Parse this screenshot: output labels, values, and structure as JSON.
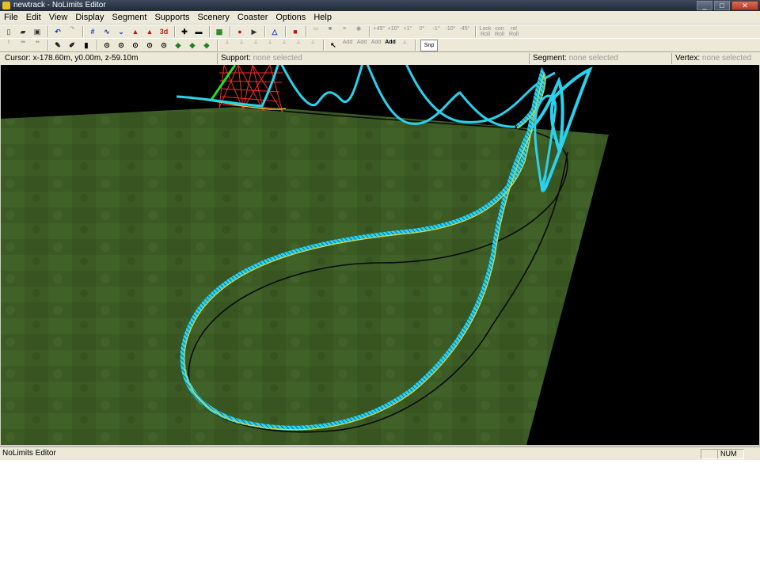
{
  "window": {
    "title": "newtrack - NoLimits Editor"
  },
  "window_buttons": [
    "_",
    "□",
    "✕"
  ],
  "menu": [
    "File",
    "Edit",
    "View",
    "Display",
    "Segment",
    "Supports",
    "Scenery",
    "Coaster",
    "Options",
    "Help"
  ],
  "toolbar_top": {
    "view_3d": "3d",
    "roll_tools": [
      "+45°",
      "+10°",
      "+1°",
      "0°",
      "-1°",
      "-10°",
      "-45°"
    ],
    "lock_roll": "Lock\nRoll",
    "con_roll": "con\nRoll",
    "rel_roll": "rel\nRoll"
  },
  "toolbar_bottom": {
    "add_tools": [
      "Add",
      "Add",
      "Add",
      "Add"
    ],
    "snap": "Snp"
  },
  "status": {
    "cursor_label": "Cursor:",
    "cursor_value": "x-178.60m, y0.00m, z-59.10m",
    "support_label": "Support:",
    "support_value": "none selected",
    "segment_label": "Segment:",
    "segment_value": "none selected",
    "vertex_label": "Vertex:",
    "vertex_value": "none selected"
  },
  "bottom_status": {
    "message": "NoLimits Editor",
    "num": "NUM"
  },
  "colors": {
    "ground": "#3b5a24",
    "track": "#29d2ee",
    "rail": "#d6d83a",
    "support": "#ff2020",
    "lift": "#22e022"
  }
}
